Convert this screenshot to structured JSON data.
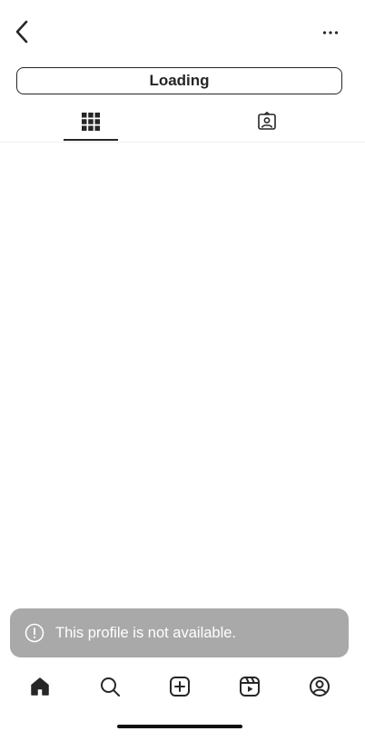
{
  "header": {
    "back_icon": "chevron-left-icon",
    "more_icon": "ellipsis-icon"
  },
  "profile": {
    "loading_label": "Loading"
  },
  "tabs": [
    {
      "icon": "grid-icon",
      "active": true
    },
    {
      "icon": "tagged-person-icon",
      "active": false
    }
  ],
  "toast": {
    "icon": "alert-circle-icon",
    "message": "This profile is not available."
  },
  "bottom_nav": [
    {
      "icon": "home-icon",
      "active": true
    },
    {
      "icon": "search-icon",
      "active": false
    },
    {
      "icon": "create-plus-icon",
      "active": false
    },
    {
      "icon": "reels-icon",
      "active": false
    },
    {
      "icon": "profile-icon",
      "active": false
    }
  ],
  "colors": {
    "text": "#262626",
    "toast_bg": "#a9a9a9",
    "divider": "#efefef"
  }
}
